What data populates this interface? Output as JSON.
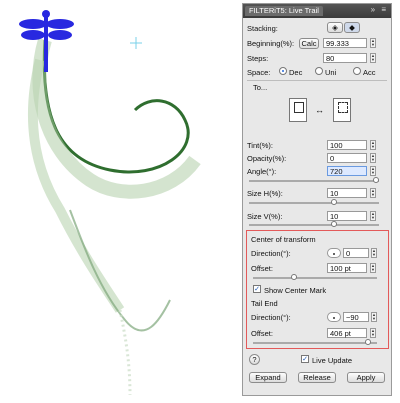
{
  "panel": {
    "tab_label": "FILTERiT5: Live Trail",
    "title_icons": "» ≡",
    "stacking_label": "Stacking:",
    "beginning_label": "Beginning(%):",
    "calc_label": "Calc",
    "beginning_value": "99.333",
    "steps_label": "Steps:",
    "steps_value": "80",
    "space_label": "Space:",
    "space_options": [
      "Dec",
      "Uni",
      "Acc"
    ],
    "space_selected": "Dec",
    "to_label": "To...",
    "preview_swap": "↔",
    "tint_label": "Tint(%):",
    "tint_value": "100",
    "opacity_label": "Opacity(%):",
    "opacity_value": "0",
    "angle_label": "Angle(°):",
    "angle_value": "720",
    "size_h_label": "Size H(%):",
    "size_h_value": "10",
    "size_v_label": "Size V(%):",
    "size_v_value": "10",
    "center_section": "Center of transform",
    "center_direction_label": "Direction(°):",
    "center_direction_value": "0",
    "center_offset_label": "Offset:",
    "center_offset_value": "100 pt",
    "show_center_label": "Show Center Mark",
    "show_center_checked": true,
    "tail_section": "Tail End",
    "tail_direction_label": "Direction(°):",
    "tail_direction_value": "−90",
    "tail_offset_label": "Offset:",
    "tail_offset_value": "406 pt",
    "help_label": "?",
    "live_update_label": "Live Update",
    "live_update_checked": true,
    "expand_label": "Expand",
    "release_label": "Release",
    "apply_label": "Apply"
  },
  "colors": {
    "accent": "#2a6bd8",
    "highlight_box": "#e35a5a",
    "dragonfly": "#2828e0",
    "trail": "#3b7a3b"
  },
  "icons": [
    "dragonfly-artwork",
    "crosshair-icon",
    "stacking-icon"
  ]
}
